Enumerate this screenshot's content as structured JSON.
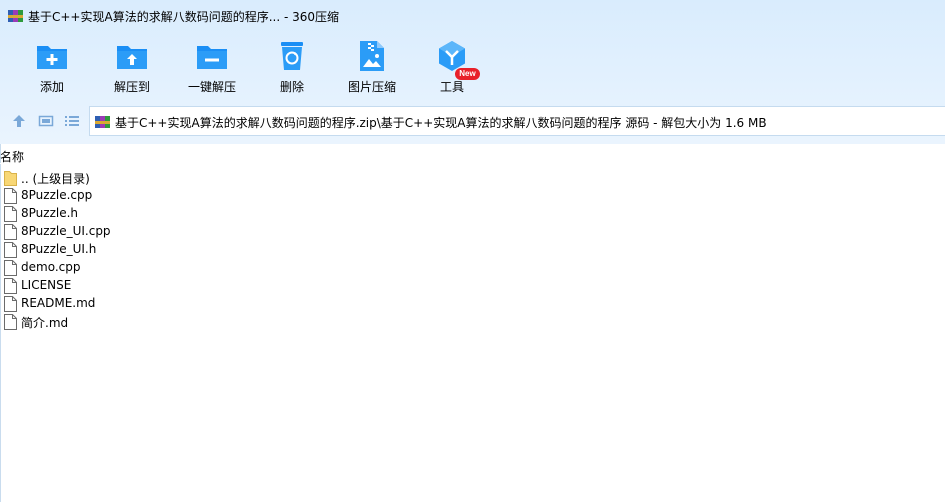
{
  "window": {
    "title": "基于C++实现A算法的求解八数码问题的程序... - 360压缩",
    "app_icon": "winrar-books-icon"
  },
  "toolbar": {
    "items": [
      {
        "label": "添加",
        "icon": "add-folder-icon"
      },
      {
        "label": "解压到",
        "icon": "extract-folder-icon"
      },
      {
        "label": "一键解压",
        "icon": "one-click-extract-icon"
      },
      {
        "label": "删除",
        "icon": "recycle-bin-icon"
      },
      {
        "label": "图片压缩",
        "icon": "image-compress-icon"
      },
      {
        "label": "工具",
        "icon": "tools-cube-icon"
      }
    ],
    "new_badge": "New"
  },
  "navbar": {
    "path": "基于C++实现A算法的求解八数码问题的程序.zip\\基于C++实现A算法的求解八数码问题的程序 源码 - 解包大小为 1.6 MB"
  },
  "list": {
    "column_name": "名称",
    "items": [
      {
        "name": ".. (上级目录)",
        "type": "folder"
      },
      {
        "name": "8Puzzle.cpp",
        "type": "file"
      },
      {
        "name": "8Puzzle.h",
        "type": "file"
      },
      {
        "name": "8Puzzle_UI.cpp",
        "type": "file"
      },
      {
        "name": "8Puzzle_UI.h",
        "type": "file"
      },
      {
        "name": "demo.cpp",
        "type": "file"
      },
      {
        "name": "LICENSE",
        "type": "file"
      },
      {
        "name": "README.md",
        "type": "file"
      },
      {
        "name": "简介.md",
        "type": "file"
      }
    ]
  },
  "colors": {
    "accent": "#1a8ef5",
    "toolbar_bg": "#dcedfd",
    "badge": "#e8202a"
  }
}
